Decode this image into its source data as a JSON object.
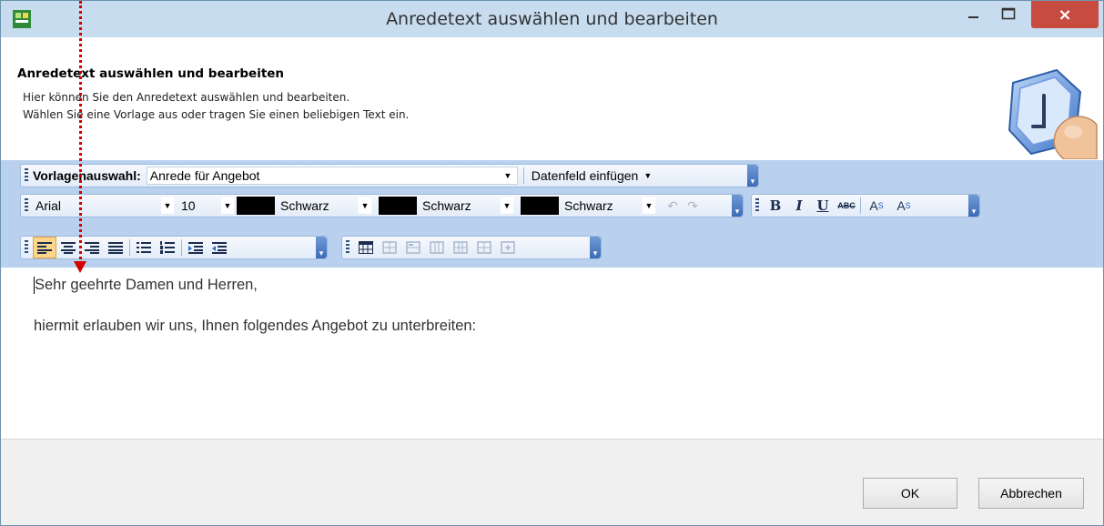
{
  "window": {
    "title": "Anredetext auswählen und bearbeiten",
    "minimize_label": "–",
    "maximize_label": "□",
    "close_label": "×"
  },
  "header": {
    "title": "Anredetext auswählen und bearbeiten",
    "line1": "Hier können Sie den Anredetext auswählen und bearbeiten.",
    "line2": "Wählen Sie eine Vorlage aus oder tragen Sie einen beliebigen Text ein.",
    "graphic_icon": "keyboard-key-finger-icon"
  },
  "toolbar1": {
    "template_label": "Vorlagenauswahl:",
    "template_value": "Anrede für Angebot",
    "insert_field_label": "Datenfeld einfügen"
  },
  "toolbar2": {
    "font_value": "Arial",
    "size_value": "10",
    "color1_label": "Schwarz",
    "color2_label": "Schwarz",
    "color3_label": "Schwarz",
    "bold": "B",
    "italic": "I",
    "underline": "U",
    "strike": "ABC",
    "superscript": "A",
    "superscript_mark": "S",
    "subscript": "A",
    "subscript_mark": "S"
  },
  "editor": {
    "line1": "Sehr geehrte Damen und Herren,",
    "line2": "hiermit erlauben wir uns, Ihnen folgendes Angebot zu unterbreiten:"
  },
  "footer": {
    "ok_label": "OK",
    "cancel_label": "Abbrechen"
  },
  "colors": {
    "titlebar": "#c7dcef",
    "toolbar_band": "#b9d1ee",
    "close_button": "#c74b3f",
    "annotation_arrow": "#d20000"
  }
}
